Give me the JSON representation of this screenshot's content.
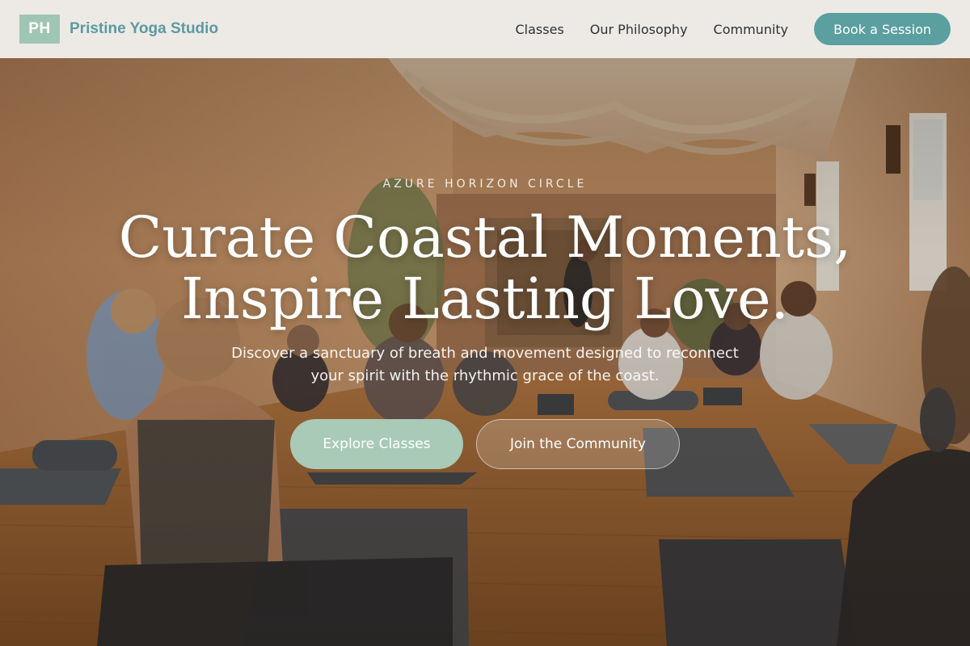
{
  "brand": {
    "logo_text": "PH",
    "name": "Pristine Yoga Studio"
  },
  "nav": {
    "links": [
      {
        "label": "Classes"
      },
      {
        "label": "Our Philosophy"
      },
      {
        "label": "Community"
      }
    ],
    "cta_label": "Book a Session"
  },
  "hero": {
    "eyebrow": "AZURE HORIZON CIRCLE",
    "headline_line1": "Curate Coastal Moments,",
    "headline_line2": "Inspire Lasting Love.",
    "subtitle": "Discover a sanctuary of breath and movement designed to reconnect your spirit with the rhythmic grace of the coast.",
    "primary_button": "Explore Classes",
    "secondary_button": "Join the Community"
  },
  "colors": {
    "accent_teal": "#5b9fa0",
    "logo_green": "#9fc6b4",
    "button_green": "#a8cab7",
    "nav_bg": "#f5f3f0"
  }
}
